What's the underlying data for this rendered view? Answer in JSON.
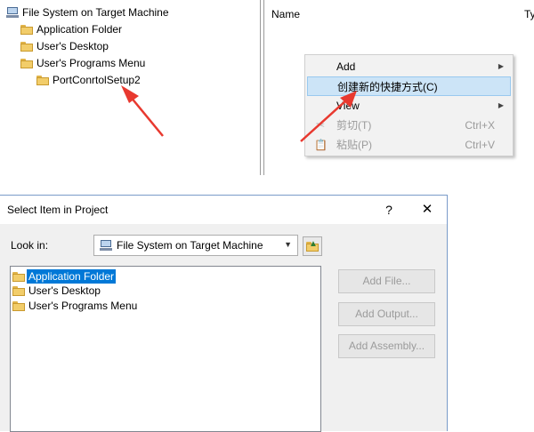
{
  "fs_tree": {
    "root": "File System on Target Machine",
    "items": [
      "Application Folder",
      "User's Desktop",
      "User's Programs Menu"
    ],
    "child": "PortConrtolSetup2"
  },
  "list_header": {
    "name": "Name",
    "type": "Ty"
  },
  "context_menu": {
    "items": [
      {
        "label": "Add",
        "submenu": true
      },
      {
        "label": "创建新的快捷方式(C)",
        "highlighted": true
      },
      {
        "label": "View",
        "submenu": true
      },
      {
        "label": "剪切(T)",
        "shortcut": "Ctrl+X",
        "disabled": true,
        "icon": "scissors-icon"
      },
      {
        "label": "粘贴(P)",
        "shortcut": "Ctrl+V",
        "disabled": true,
        "icon": "paste-icon"
      }
    ]
  },
  "dialog": {
    "title": "Select Item in Project",
    "help": "?",
    "close": "✕",
    "lookin_label": "Look in:",
    "lookin_value": "File System on Target Machine",
    "items": [
      "Application Folder",
      "User's Desktop",
      "User's Programs Menu"
    ],
    "selected_item": "Application Folder",
    "buttons": {
      "add_file": "Add File...",
      "add_output": "Add Output...",
      "add_assembly": "Add Assembly..."
    }
  },
  "colors": {
    "arrow": "#e8392f",
    "selection": "#0078d7",
    "menu_highlight": "#cce4f7"
  }
}
